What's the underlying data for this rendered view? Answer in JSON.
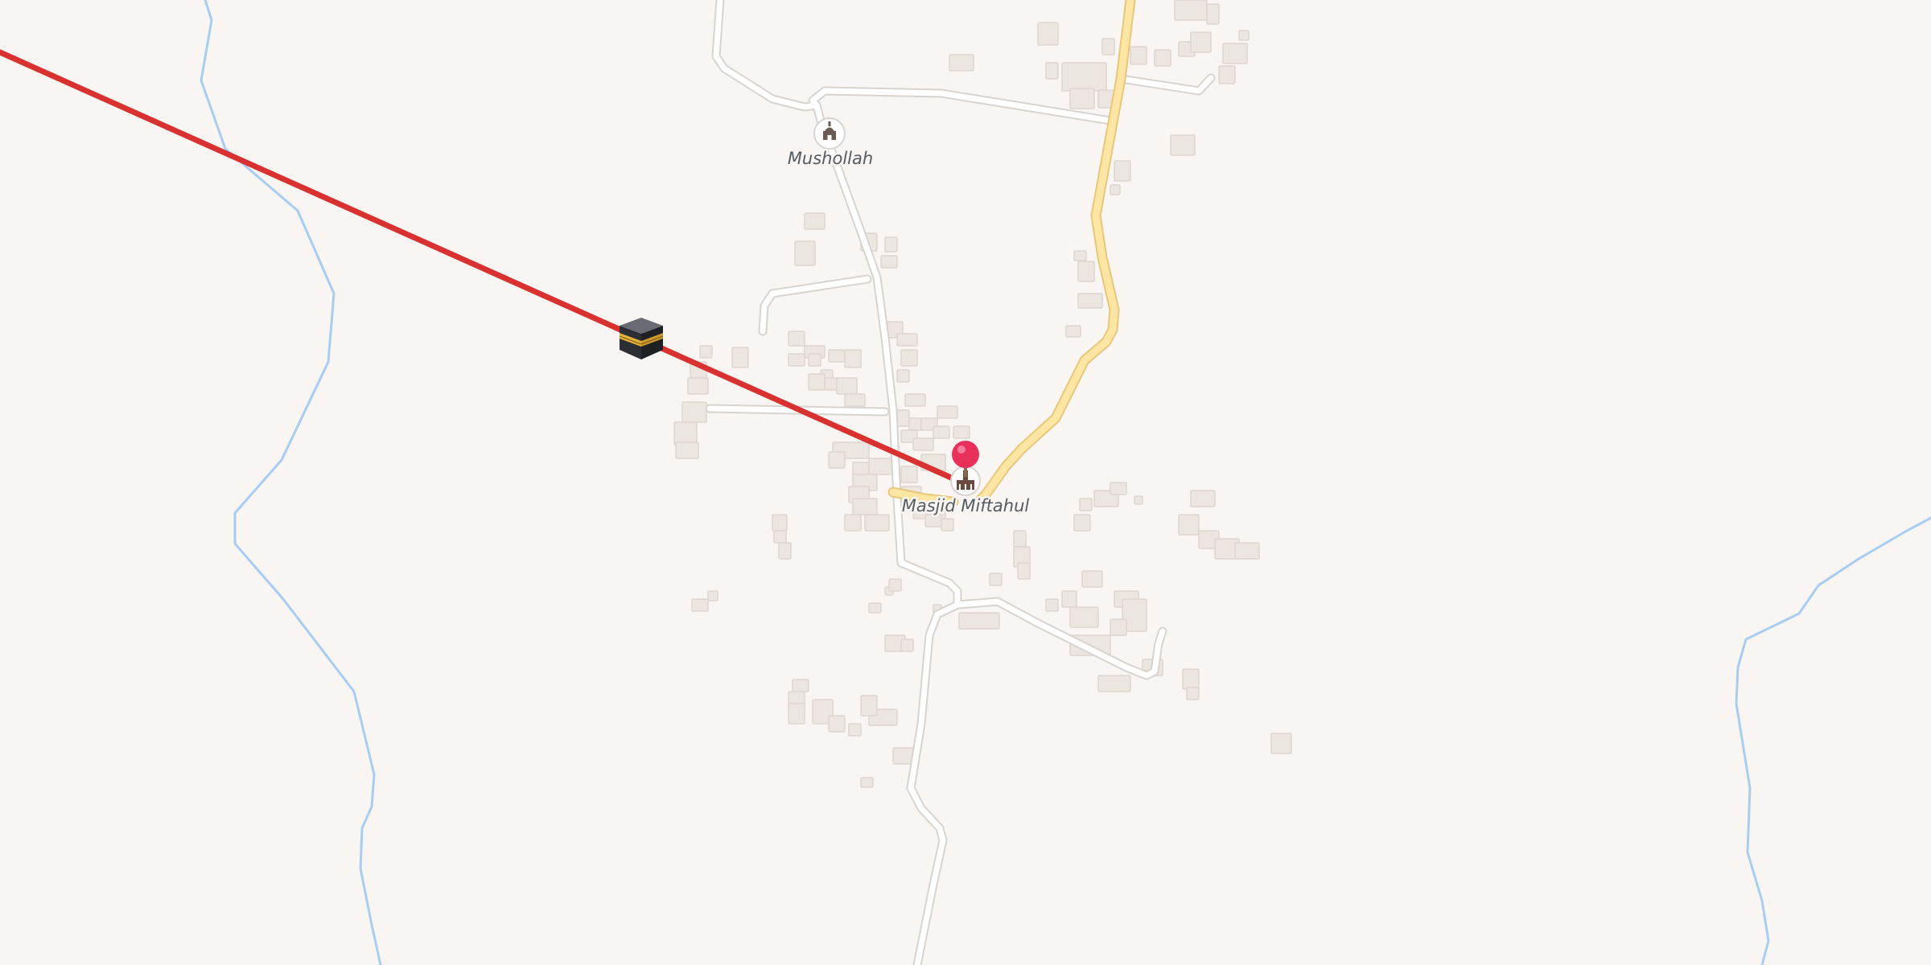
{
  "map": {
    "pois": [
      {
        "id": "mushollah",
        "label": "Mushollah",
        "icon": "mosque-icon"
      },
      {
        "id": "masjid",
        "label": "Masjid Miftahul",
        "icon": "mosque-icon"
      }
    ],
    "qibla": {
      "icon": "kaaba-icon",
      "line_color": "#d93030"
    },
    "location_pin": {
      "icon": "location-pin-icon",
      "color": "#e8305a"
    },
    "colors": {
      "background": "#f8f5f2",
      "road": "#ffffff",
      "road_casing": "#d8d3ce",
      "main_road": "#fde6a3",
      "main_road_casing": "#e8c77a",
      "water": "#a8cdf0",
      "building": "#ece6e1",
      "building_edge": "#ddd5cf"
    }
  }
}
